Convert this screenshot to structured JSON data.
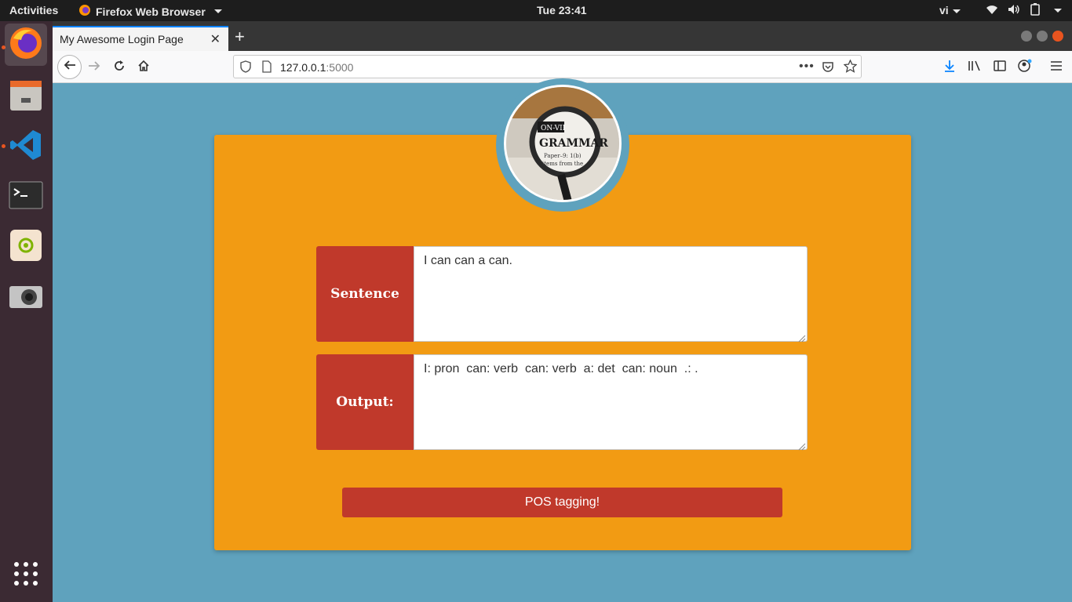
{
  "system": {
    "activities": "Activities",
    "app_name": "Firefox Web Browser",
    "clock": "Tue 23:41",
    "input_lang": "vi"
  },
  "dock": {
    "items": [
      {
        "name": "firefox"
      },
      {
        "name": "files"
      },
      {
        "name": "vscode"
      },
      {
        "name": "terminal"
      },
      {
        "name": "settings"
      },
      {
        "name": "screenshot"
      },
      {
        "name": "show-applications"
      }
    ]
  },
  "browser": {
    "tab_title": "My Awesome Login Page",
    "url_host": "127.0.0.1",
    "url_port": ":5000"
  },
  "page": {
    "avatar_image": "magnifying glass over 'GRAMMAR' text",
    "sentence_label": "Sentence",
    "sentence_value": "I can can a can.",
    "output_label": "Output:",
    "output_value": "I: pron  can: verb  can: verb  a: det  can: noun  .: .",
    "submit_label": "POS tagging!"
  },
  "colors": {
    "page_bg": "#5fa2bd",
    "card_bg": "#f29b13",
    "accent_red": "#c0392b"
  }
}
